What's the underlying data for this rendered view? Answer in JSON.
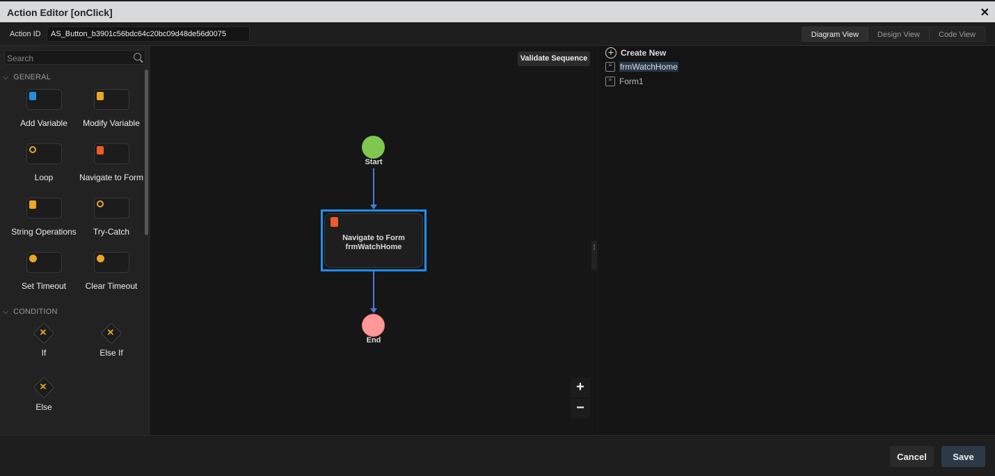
{
  "window": {
    "title": "Action Editor [onClick]",
    "close_icon": "close-icon"
  },
  "header": {
    "action_id_label": "Action ID",
    "action_id_value": "AS_Button_b3901c56bdc64c20bc09d48de56d0075",
    "views": [
      {
        "label": "Diagram View",
        "active": true
      },
      {
        "label": "Design View",
        "active": false
      },
      {
        "label": "Code View",
        "active": false
      }
    ]
  },
  "sidebar": {
    "search_placeholder": "Search",
    "general": {
      "title": "GENERAL",
      "items": [
        {
          "label": "Add Variable",
          "icon": "folder-plus-icon",
          "color": "#1e90e8"
        },
        {
          "label": "Modify Variable",
          "icon": "variable-file-icon",
          "color": "#e8a824"
        },
        {
          "label": "Loop",
          "icon": "loop-icon",
          "color": "#e8a824"
        },
        {
          "label": "Navigate to Form",
          "icon": "form-file-icon",
          "color": "#f05a28"
        },
        {
          "label": "String Operations",
          "icon": "string-file-icon",
          "color": "#e8a824"
        },
        {
          "label": "Try-Catch",
          "icon": "try-catch-icon",
          "color": "#e8a824"
        },
        {
          "label": "Set Timeout",
          "icon": "timer-icon",
          "color": "#e8a824"
        },
        {
          "label": "Clear Timeout",
          "icon": "timer-icon",
          "color": "#e8a824"
        }
      ]
    },
    "condition": {
      "title": "CONDITION",
      "items": [
        {
          "label": "If"
        },
        {
          "label": "Else If"
        },
        {
          "label": "Else"
        }
      ]
    }
  },
  "canvas": {
    "validate_label": "Validate Sequence",
    "start_label": "Start",
    "end_label": "End",
    "node": {
      "line1": "Navigate to Form",
      "line2": "frmWatchHome"
    },
    "zoom_in": "+",
    "zoom_out": "−"
  },
  "right_panel": {
    "create_new": "Create New",
    "forms": [
      {
        "label": "frmWatchHome",
        "selected": true
      },
      {
        "label": "Form1",
        "selected": false
      }
    ]
  },
  "footer": {
    "cancel": "Cancel",
    "save": "Save"
  }
}
